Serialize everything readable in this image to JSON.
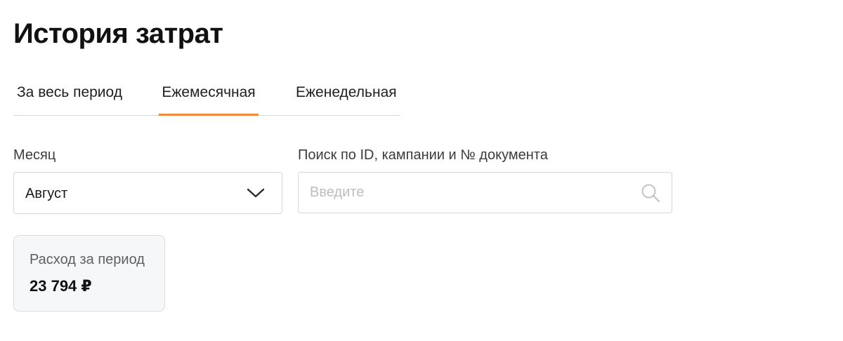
{
  "page": {
    "title": "История затрат"
  },
  "tabs": [
    {
      "label": "За весь период",
      "active": false
    },
    {
      "label": "Ежемесячная",
      "active": true
    },
    {
      "label": "Еженедельная",
      "active": false
    }
  ],
  "filters": {
    "month": {
      "label": "Месяц",
      "value": "Август",
      "icon": "chevron-down-icon"
    },
    "search": {
      "label": "Поиск по ID, кампании и № документа",
      "placeholder": "Введите",
      "value": "",
      "icon": "search-icon"
    }
  },
  "summary": {
    "label": "Расход за период",
    "value": "23 794 ₽"
  },
  "colors": {
    "accent": "#f08a3c",
    "border": "#d6d6d6",
    "card_background": "#f6f7f9",
    "placeholder": "#bdbdbd"
  }
}
